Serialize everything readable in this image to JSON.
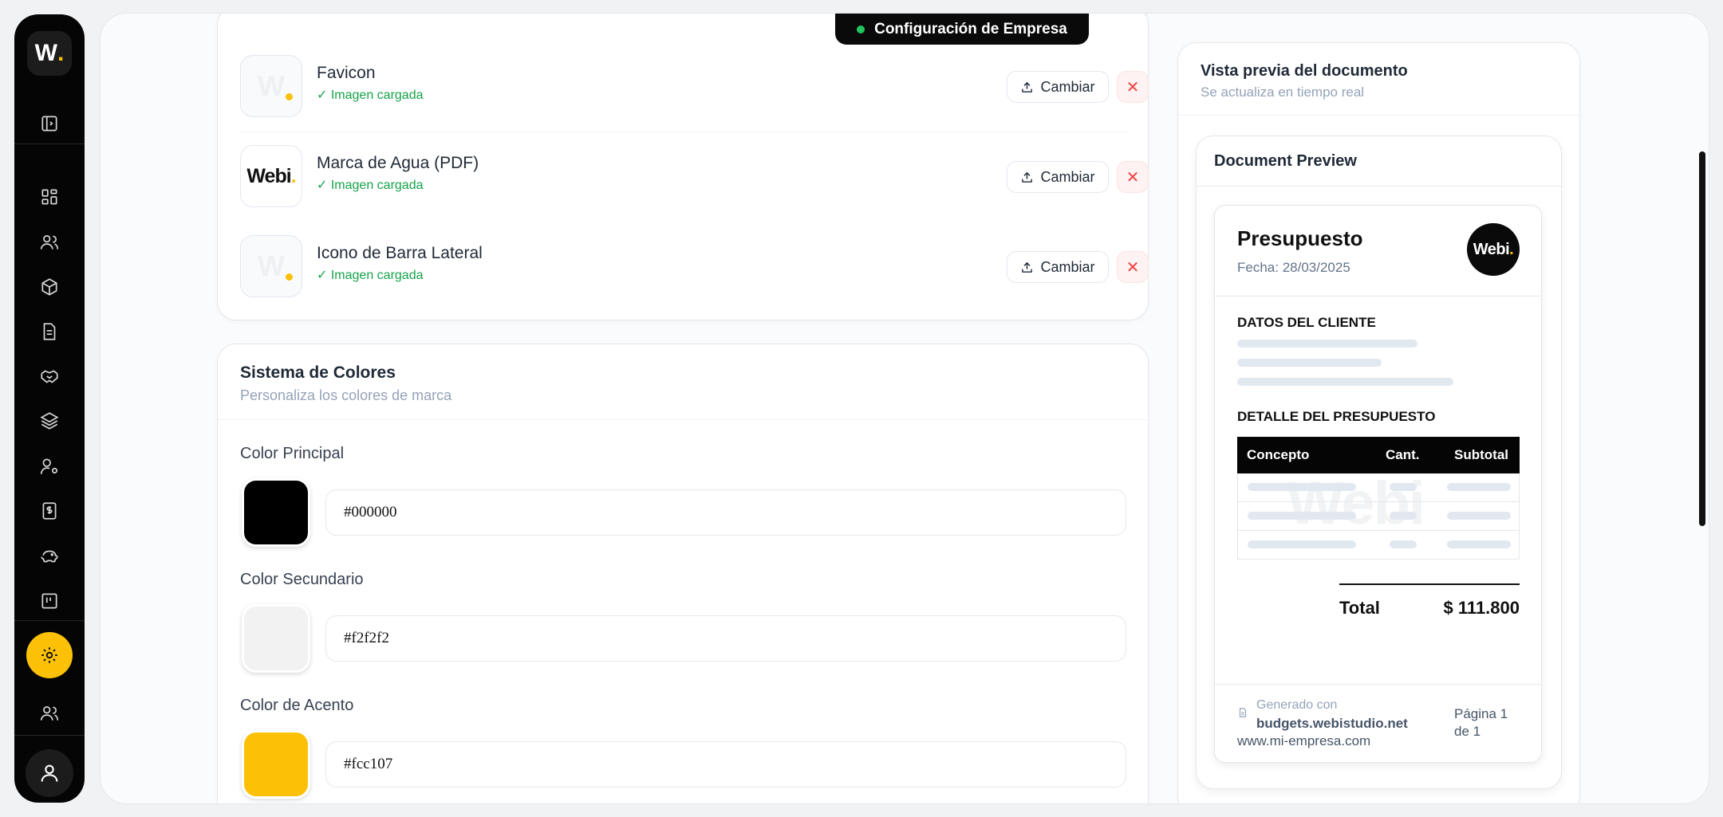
{
  "sidebar": {
    "logo_letter": "W",
    "logo_dot": ".",
    "icons": [
      "panel-toggle-icon",
      "dashboard-icon",
      "users-icon",
      "box-icon",
      "document-icon",
      "handshake-icon",
      "layers-icon",
      "user-settings-icon",
      "invoice-icon",
      "piggy-bank-icon",
      "kanban-icon",
      "settings-icon",
      "team-icon",
      "user-icon"
    ]
  },
  "badge": {
    "text": "Configuración de Empresa"
  },
  "assets": {
    "items": [
      {
        "name": "Favicon",
        "status": "✓ Imagen cargada",
        "change_label": "Cambiar"
      },
      {
        "name": "Marca de Agua (PDF)",
        "status": "✓ Imagen cargada",
        "change_label": "Cambiar",
        "thumb_text": "Webi",
        "thumb_dot": "."
      },
      {
        "name": "Icono de Barra Lateral",
        "status": "✓ Imagen cargada",
        "change_label": "Cambiar"
      }
    ],
    "remove_symbol": "✕",
    "ghost_letter": "W"
  },
  "colors": {
    "title": "Sistema de Colores",
    "subtitle": "Personaliza los colores de marca",
    "fields": [
      {
        "label": "Color Principal",
        "value": "#000000",
        "swatch": "#000000"
      },
      {
        "label": "Color Secundario",
        "value": "#f2f2f2",
        "swatch": "#f2f2f2"
      },
      {
        "label": "Color de Acento",
        "value": "#fcc107",
        "swatch": "#fcc107"
      }
    ]
  },
  "preview": {
    "title": "Vista previa del documento",
    "subtitle": "Se actualiza en tiempo real",
    "inner_title": "Document Preview",
    "doc": {
      "heading": "Presupuesto",
      "date": "Fecha: 28/03/2025",
      "logo_text": "Webi",
      "logo_dot": ".",
      "client_section": "DATOS DEL CLIENTE",
      "detail_section": "DETALLE DEL PRESUPUESTO",
      "columns": [
        "Concepto",
        "Cant.",
        "Subtotal"
      ],
      "watermark": "Webi",
      "total_label": "Total",
      "total_value": "$ 111.800",
      "footer_generated": "Generado con",
      "footer_link": "budgets.webistudio.net",
      "footer_site": "www.mi-empresa.com",
      "footer_page": "Página 1 de 1"
    }
  }
}
